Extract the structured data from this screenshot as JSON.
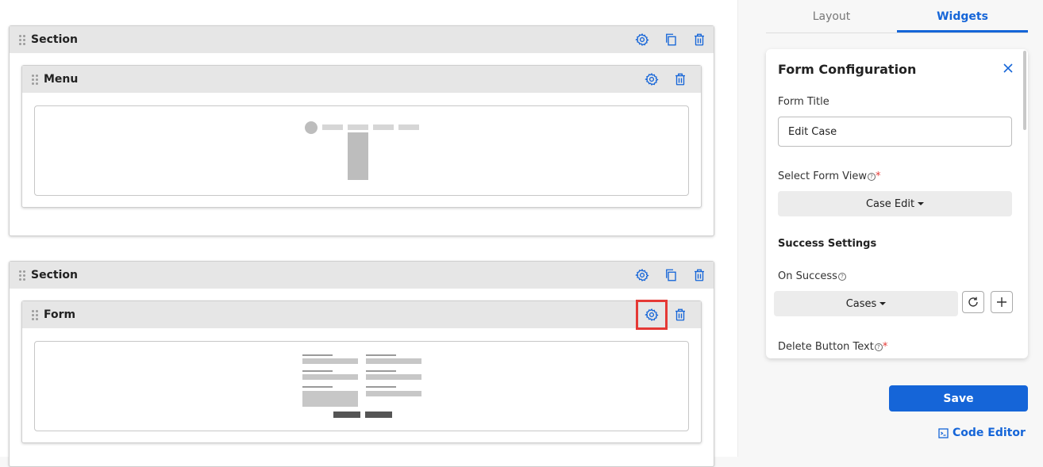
{
  "builder": {
    "section1": {
      "title": "Section"
    },
    "menu_widget": {
      "title": "Menu"
    },
    "section2": {
      "title": "Section"
    },
    "form_widget": {
      "title": "Form"
    }
  },
  "panel": {
    "tabs": [
      {
        "label": "Layout"
      },
      {
        "label": "Widgets",
        "active": true
      }
    ],
    "form_config": {
      "title": "Form Configuration",
      "form_title_label": "Form Title",
      "form_title_value": "Edit Case",
      "form_view_label": "Select Form View",
      "form_view_value": "Case Edit",
      "success_heading": "Success Settings",
      "on_success_label": "On Success",
      "on_success_value": "Cases",
      "delete_btn_label": "Delete Button Text",
      "required_mark": "*",
      "help_glyph": "?"
    },
    "save_label": "Save",
    "code_editor_label": "Code Editor"
  },
  "colors": {
    "accent": "#1565d8",
    "required": "#e53935",
    "highlight": "#e53935"
  },
  "icons": [
    "drag-handle-icon",
    "gear-icon",
    "copy-icon",
    "trash-icon",
    "close-icon",
    "help-icon",
    "refresh-icon",
    "plus-icon",
    "code-editor-icon",
    "caret-down-icon"
  ]
}
